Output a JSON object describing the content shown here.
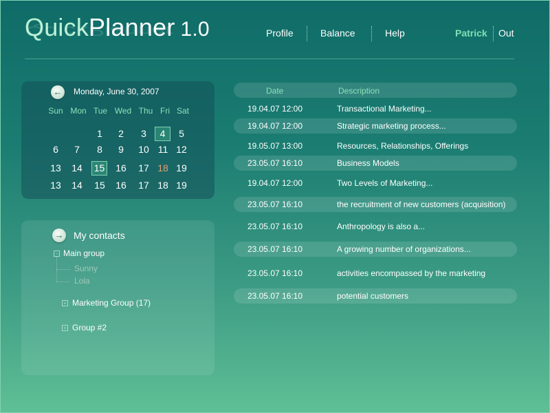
{
  "app": {
    "title_quick": "Quick",
    "title_planner": "Planner",
    "version": "1.0"
  },
  "nav": {
    "items": [
      "Profile",
      "Balance",
      "Help"
    ],
    "user": "Patrick",
    "logout": "Out"
  },
  "calendar": {
    "date_label": "Monday, June 30, 2007",
    "weekdays": [
      "Sun",
      "Mon",
      "Tue",
      "Wed",
      "Thu",
      "Fri",
      "Sat"
    ],
    "weeks": [
      [
        "",
        "",
        "1",
        "2",
        "3",
        "4",
        "5"
      ],
      [
        "6",
        "7",
        "8",
        "9",
        "10",
        "11",
        "12"
      ],
      [
        "13",
        "14",
        "15",
        "16",
        "17",
        "18",
        "19"
      ],
      [
        "13",
        "14",
        "15",
        "16",
        "17",
        "18",
        "19"
      ]
    ],
    "highlighted": [
      "4",
      "15"
    ],
    "marked": [
      "18"
    ],
    "accent_color": "#e8a070"
  },
  "contacts": {
    "title": "My contacts",
    "groups": [
      {
        "label": "Main group",
        "expanded": true,
        "members": [
          "Sunny",
          "Lola"
        ]
      },
      {
        "label": "Marketing Group (17)",
        "expanded": false,
        "members": []
      },
      {
        "label": "Group #2",
        "expanded": false,
        "members": []
      }
    ]
  },
  "schedule": {
    "columns": [
      "Date",
      "Description"
    ],
    "rows": [
      {
        "date": "19.04.07 12:00",
        "description": "Transactional Marketing..."
      },
      {
        "date": "19.04.07 12:00",
        "description": "Strategic marketing process..."
      },
      {
        "date": "19.05.07 13:00",
        "description": "Resources, Relationships, Offerings"
      },
      {
        "date": "23.05.07 16:10",
        "description": "Business Models"
      },
      {
        "date": "19.04.07 12:00",
        "description": "Two Levels of Marketing..."
      },
      {
        "date": "23.05.07 16:10",
        "description": "the recruitment of new customers (acquisition)"
      },
      {
        "date": "23.05.07 16:10",
        "description": "Anthropology is also a..."
      },
      {
        "date": "23.05.07 16:10",
        "description": "A growing number of organizations..."
      },
      {
        "date": "23.05.07 16:10",
        "description": "activities encompassed by the marketing"
      },
      {
        "date": "23.05.07 16:10",
        "description": "potential customers"
      }
    ]
  },
  "icons": {
    "calendar_back": "arrow-left-icon",
    "contacts_go": "arrow-right-icon",
    "collapse": "minus-box-icon",
    "expand": "plus-box-icon"
  }
}
